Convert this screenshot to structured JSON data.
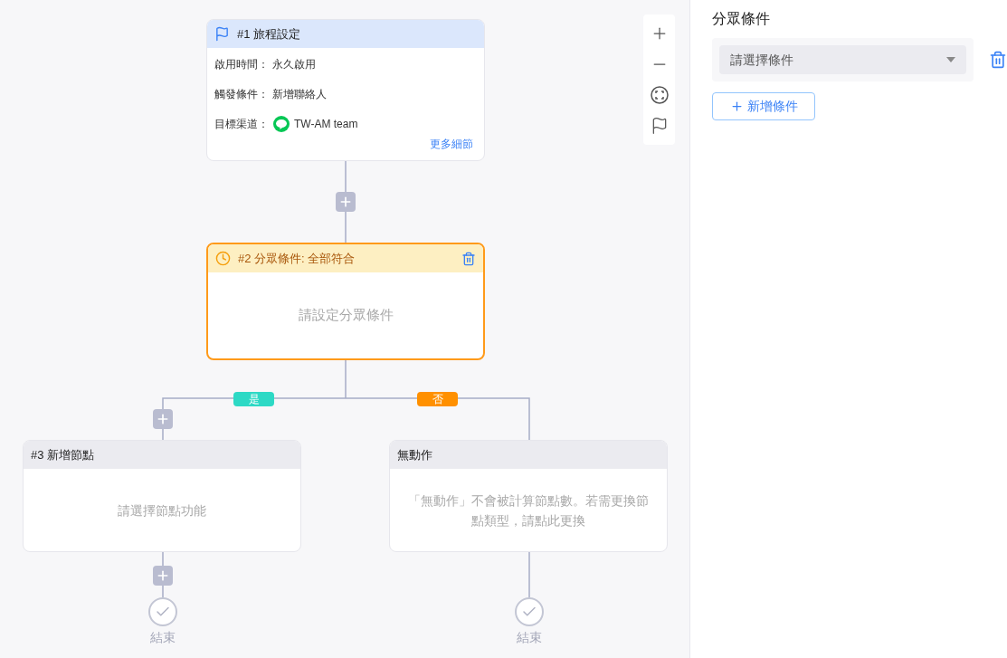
{
  "trigger": {
    "title": "#1 旅程設定",
    "selected": false,
    "fields": [
      {
        "kind": "text",
        "label": "啟用時間：",
        "value": "永久啟用"
      },
      {
        "kind": "text",
        "label": "觸發條件：",
        "value": "新增聯絡人"
      },
      {
        "kind": "channel",
        "label": "目標渠道：",
        "value": "TW-AM team"
      }
    ],
    "link": "更多細節"
  },
  "condition": {
    "title": "#2 分眾條件: 全部符合",
    "message": "請設定分眾條件",
    "selected": true
  },
  "branches": [
    {
      "label": "是",
      "color": "#2dd9c5",
      "node": {
        "title": "#3 新增節點",
        "message": "請選擇節點功能",
        "selected": false
      },
      "add_after": true,
      "end": "結束"
    },
    {
      "label": "否",
      "color": "#ff9000",
      "node": {
        "title": "無動作",
        "message": "「無動作」不會被計算節點數。若需更換節點類型，請點此更換",
        "selected": false
      },
      "add_after": false,
      "end": "結束"
    }
  ],
  "panel": {
    "title": "分眾條件",
    "conditions": [
      {
        "placeholder": "請選擇條件"
      }
    ],
    "add_button": "新增條件"
  }
}
